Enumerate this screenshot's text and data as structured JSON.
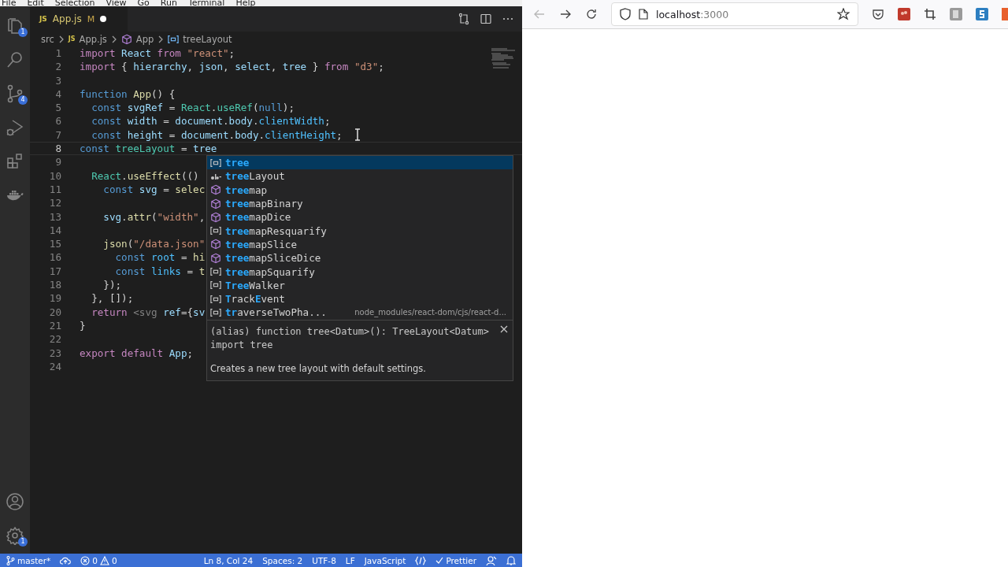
{
  "menu_bar": [
    "File",
    "Edit",
    "Selection",
    "View",
    "Go",
    "Run",
    "Terminal",
    "Help"
  ],
  "activity_bar": [
    {
      "kind": "files",
      "badge": "1"
    },
    {
      "kind": "search"
    },
    {
      "kind": "source-control",
      "badge": "4"
    },
    {
      "kind": "run-debug"
    },
    {
      "kind": "extensions"
    },
    {
      "kind": "docker"
    }
  ],
  "activity_bar_bottom": [
    {
      "kind": "account"
    },
    {
      "kind": "settings",
      "badge": "1"
    }
  ],
  "tab": {
    "lang": "JS",
    "title": "App.js",
    "status": "M",
    "unsaved": true
  },
  "breadcrumbs": [
    {
      "kind": "folder",
      "label": "src"
    },
    {
      "kind": "js",
      "lang": "JS",
      "label": "App.js"
    },
    {
      "kind": "module",
      "label": "App"
    },
    {
      "kind": "variable",
      "label": "treeLayout"
    }
  ],
  "code_lines": [
    {
      "num": "1",
      "current": false,
      "tokens": [
        {
          "kind": "keyword",
          "text": "import"
        },
        {
          "kind": "variable",
          "text": " React"
        },
        {
          "kind": "keyword",
          "text": " from"
        },
        {
          "kind": "string",
          "text": " \"react\""
        },
        {
          "kind": "plain",
          "text": ";"
        }
      ]
    },
    {
      "num": "2",
      "current": false,
      "tokens": [
        {
          "kind": "keyword",
          "text": "import"
        },
        {
          "kind": "plain",
          "text": " { "
        },
        {
          "kind": "variable",
          "text": "hierarchy"
        },
        {
          "kind": "plain",
          "text": ", "
        },
        {
          "kind": "variable",
          "text": "json"
        },
        {
          "kind": "plain",
          "text": ", "
        },
        {
          "kind": "variable",
          "text": "select"
        },
        {
          "kind": "plain",
          "text": ", "
        },
        {
          "kind": "variable",
          "text": "tree"
        },
        {
          "kind": "plain",
          "text": " } "
        },
        {
          "kind": "keyword",
          "text": "from"
        },
        {
          "kind": "string",
          "text": " \"d3\""
        },
        {
          "kind": "plain",
          "text": ";"
        }
      ]
    },
    {
      "num": "3",
      "current": false
    },
    {
      "num": "4",
      "current": false,
      "tokens": [
        {
          "kind": "storage",
          "text": "function"
        },
        {
          "kind": "function",
          "text": " App"
        },
        {
          "kind": "plain",
          "text": "() {"
        }
      ]
    },
    {
      "num": "5",
      "current": false,
      "tokens": [
        {
          "kind": "storage",
          "text": "  const"
        },
        {
          "kind": "variable",
          "text": " svgRef"
        },
        {
          "kind": "plain",
          "text": " = "
        },
        {
          "kind": "class",
          "text": "React"
        },
        {
          "kind": "plain",
          "text": "."
        },
        {
          "kind": "class",
          "text": "useRef"
        },
        {
          "kind": "plain",
          "text": "("
        },
        {
          "kind": "storage",
          "text": "null"
        },
        {
          "kind": "plain",
          "text": ");"
        }
      ]
    },
    {
      "num": "6",
      "current": false,
      "tokens": [
        {
          "kind": "storage",
          "text": "  const"
        },
        {
          "kind": "variable",
          "text": " width"
        },
        {
          "kind": "plain",
          "text": " = "
        },
        {
          "kind": "variable",
          "text": "document"
        },
        {
          "kind": "plain",
          "text": "."
        },
        {
          "kind": "variable",
          "text": "body"
        },
        {
          "kind": "plain",
          "text": "."
        },
        {
          "kind": "property",
          "text": "clientWidth"
        },
        {
          "kind": "plain",
          "text": ";"
        }
      ]
    },
    {
      "num": "7",
      "current": false,
      "tokens": [
        {
          "kind": "storage",
          "text": "  const"
        },
        {
          "kind": "variable",
          "text": " height"
        },
        {
          "kind": "plain",
          "text": " = "
        },
        {
          "kind": "variable",
          "text": "document"
        },
        {
          "kind": "plain",
          "text": "."
        },
        {
          "kind": "variable",
          "text": "body"
        },
        {
          "kind": "plain",
          "text": "."
        },
        {
          "kind": "property",
          "text": "clientHeight"
        },
        {
          "kind": "plain",
          "text": ";"
        }
      ]
    },
    {
      "num": "8",
      "current": true,
      "tokens": [
        {
          "kind": "storage",
          "text": "const"
        },
        {
          "kind": "class",
          "text": " treeLayout"
        },
        {
          "kind": "plain",
          "text": " = "
        },
        {
          "kind": "variable",
          "text": "tree"
        }
      ]
    },
    {
      "num": "9",
      "current": false
    },
    {
      "num": "10",
      "current": false,
      "tokens": [
        {
          "kind": "class",
          "text": "  React"
        },
        {
          "kind": "plain",
          "text": "."
        },
        {
          "kind": "function",
          "text": "useEffect"
        },
        {
          "kind": "plain",
          "text": "(()"
        }
      ]
    },
    {
      "num": "11",
      "current": false,
      "tokens": [
        {
          "kind": "storage",
          "text": "    const"
        },
        {
          "kind": "variable",
          "text": " svg"
        },
        {
          "kind": "plain",
          "text": " = "
        },
        {
          "kind": "function",
          "text": "selec"
        }
      ]
    },
    {
      "num": "12",
      "current": false
    },
    {
      "num": "13",
      "current": false,
      "tokens": [
        {
          "kind": "variable",
          "text": "    svg"
        },
        {
          "kind": "plain",
          "text": "."
        },
        {
          "kind": "function",
          "text": "attr"
        },
        {
          "kind": "plain",
          "text": "("
        },
        {
          "kind": "string",
          "text": "\"width\""
        },
        {
          "kind": "plain",
          "text": ","
        }
      ]
    },
    {
      "num": "14",
      "current": false
    },
    {
      "num": "15",
      "current": false,
      "tokens": [
        {
          "kind": "function",
          "text": "    json"
        },
        {
          "kind": "plain",
          "text": "("
        },
        {
          "kind": "string",
          "text": "\"/data.json\""
        }
      ]
    },
    {
      "num": "16",
      "current": false,
      "tokens": [
        {
          "kind": "storage",
          "text": "      const"
        },
        {
          "kind": "property",
          "text": " root"
        },
        {
          "kind": "plain",
          "text": " = "
        },
        {
          "kind": "function",
          "text": "hi"
        }
      ]
    },
    {
      "num": "17",
      "current": false,
      "tokens": [
        {
          "kind": "storage",
          "text": "      const"
        },
        {
          "kind": "property",
          "text": " links"
        },
        {
          "kind": "plain",
          "text": " = "
        },
        {
          "kind": "function",
          "text": "t"
        }
      ]
    },
    {
      "num": "18",
      "current": false,
      "tokens": [
        {
          "kind": "plain",
          "text": "    });"
        }
      ]
    },
    {
      "num": "19",
      "current": false,
      "tokens": [
        {
          "kind": "plain",
          "text": "  }, []);"
        }
      ]
    },
    {
      "num": "20",
      "current": false,
      "tokens": [
        {
          "kind": "keyword",
          "text": "  return"
        },
        {
          "kind": "tag",
          "text": " <svg"
        },
        {
          "kind": "variable",
          "text": " ref"
        },
        {
          "kind": "plain",
          "text": "={"
        },
        {
          "kind": "variable",
          "text": "sv"
        }
      ]
    },
    {
      "num": "21",
      "current": false,
      "tokens": [
        {
          "kind": "plain",
          "text": "}"
        }
      ]
    },
    {
      "num": "22",
      "current": false
    },
    {
      "num": "23",
      "current": false,
      "tokens": [
        {
          "kind": "keyword",
          "text": "export"
        },
        {
          "kind": "keyword",
          "text": " default"
        },
        {
          "kind": "variable",
          "text": " App"
        },
        {
          "kind": "plain",
          "text": ";"
        }
      ]
    },
    {
      "num": "24",
      "current": false
    }
  ],
  "suggestions": [
    {
      "label": "**tree**",
      "kind": "variable",
      "selected": true
    },
    {
      "label": "**tree**Layout",
      "kind": "text",
      "selected": false
    },
    {
      "label": "**tree**map",
      "kind": "module",
      "selected": false
    },
    {
      "label": "**tree**mapBinary",
      "kind": "module",
      "selected": false
    },
    {
      "label": "**tree**mapDice",
      "kind": "module",
      "selected": false
    },
    {
      "label": "**tree**mapResquarify",
      "kind": "variable",
      "selected": false
    },
    {
      "label": "**tree**mapSlice",
      "kind": "module",
      "selected": false
    },
    {
      "label": "**tree**mapSliceDice",
      "kind": "module",
      "selected": false
    },
    {
      "label": "**tree**mapSquarify",
      "kind": "variable",
      "selected": false
    },
    {
      "label": "**Tree**Walker",
      "kind": "variable",
      "selected": false
    },
    {
      "label": "**T**rack**E**vent",
      "kind": "variable",
      "selected": false
    },
    {
      "label": "**tr**averseTwoPha...",
      "kind": "variable",
      "selected": false,
      "detail": "node_modules/react-dom/cjs/react-d..."
    }
  ],
  "details": {
    "signature": "(alias) function tree<Datum>(): TreeLayout<Datum> import tree",
    "description": "Creates a new tree layout with default settings."
  },
  "status_bar": {
    "branch": "master*",
    "errors": "0",
    "warnings": "0",
    "position": "Ln 8, Col 24",
    "indent": "Spaces: 2",
    "encoding": "UTF-8",
    "eol": "LF",
    "language": "JavaScript",
    "formatter": "Prettier"
  },
  "browser": {
    "url_host": "localhost",
    "url_port": ":3000",
    "back_disabled": true
  }
}
